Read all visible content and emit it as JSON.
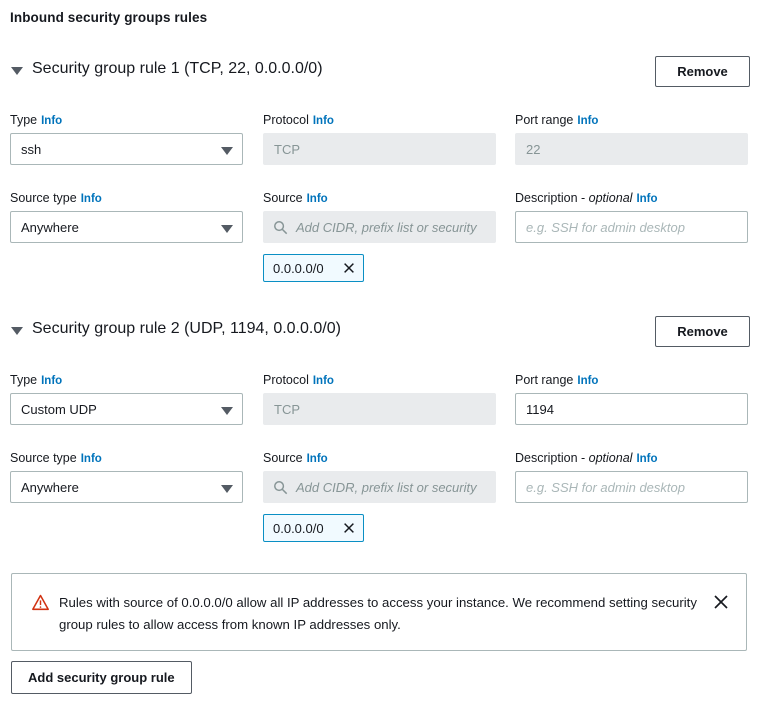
{
  "section": {
    "title": "Inbound security groups rules"
  },
  "labels": {
    "type": "Type",
    "protocol": "Protocol",
    "port_range": "Port range",
    "source_type": "Source type",
    "source": "Source",
    "description": "Description - ",
    "description_optional": "optional",
    "info": "Info"
  },
  "placeholders": {
    "source": "Add CIDR, prefix list or security",
    "description": "e.g. SSH for admin desktop"
  },
  "rules": [
    {
      "header": "Security group rule 1 (TCP, 22, 0.0.0.0/0)",
      "remove_label": "Remove",
      "type_value": "ssh",
      "protocol_value": "TCP",
      "protocol_disabled": true,
      "port_value": "22",
      "port_disabled": true,
      "source_type_value": "Anywhere",
      "source_value": "",
      "description_value": "",
      "token": "0.0.0.0/0"
    },
    {
      "header": "Security group rule 2 (UDP, 1194, 0.0.0.0/0)",
      "remove_label": "Remove",
      "type_value": "Custom UDP",
      "protocol_value": "TCP",
      "protocol_disabled": true,
      "port_value": "1194",
      "port_disabled": false,
      "source_type_value": "Anywhere",
      "source_value": "",
      "description_value": "",
      "token": "0.0.0.0/0"
    }
  ],
  "alert": {
    "message": "Rules with source of 0.0.0.0/0 allow all IP addresses to access your instance. We recommend setting security group rules to allow access from known IP addresses only.",
    "icon": "warning-triangle-icon",
    "close_icon": "close-icon"
  },
  "footer": {
    "add_rule_label": "Add security group rule"
  },
  "colors": {
    "link": "#0073bb",
    "warning": "#d13212",
    "token_border": "#0a8fc4",
    "token_bg": "#f1faff",
    "disabled_bg": "#e9ebed",
    "border": "#aab7b8",
    "text": "#16191f"
  }
}
